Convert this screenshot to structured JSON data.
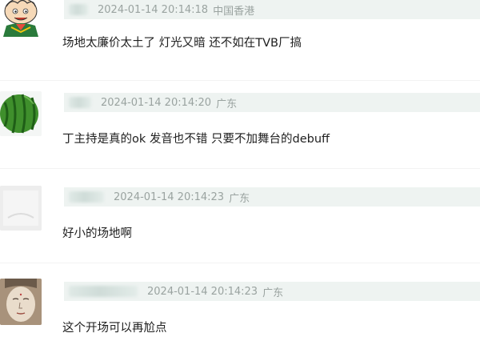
{
  "comments": [
    {
      "timestamp": "2024-01-14 20:14:18",
      "location": "中国香港",
      "text": "场地太廉价太土了 灯光又暗 还不如在TVB厂搞",
      "avatar_icon": "cartoon-boy-avatar-icon"
    },
    {
      "timestamp": "2024-01-14 20:14:20",
      "location": "广东",
      "text": "丁主持是真的ok 发音也不错 只要不加舞台的debuff",
      "avatar_icon": "watermelon-avatar-icon"
    },
    {
      "timestamp": "2024-01-14 20:14:23",
      "location": "广东",
      "text": "好小的场地啊",
      "avatar_icon": "blank-gray-avatar-icon"
    },
    {
      "timestamp": "2024-01-14 20:14:23",
      "location": "广东",
      "text": "这个开场可以再尬点",
      "avatar_icon": "buddha-face-avatar-icon"
    }
  ]
}
